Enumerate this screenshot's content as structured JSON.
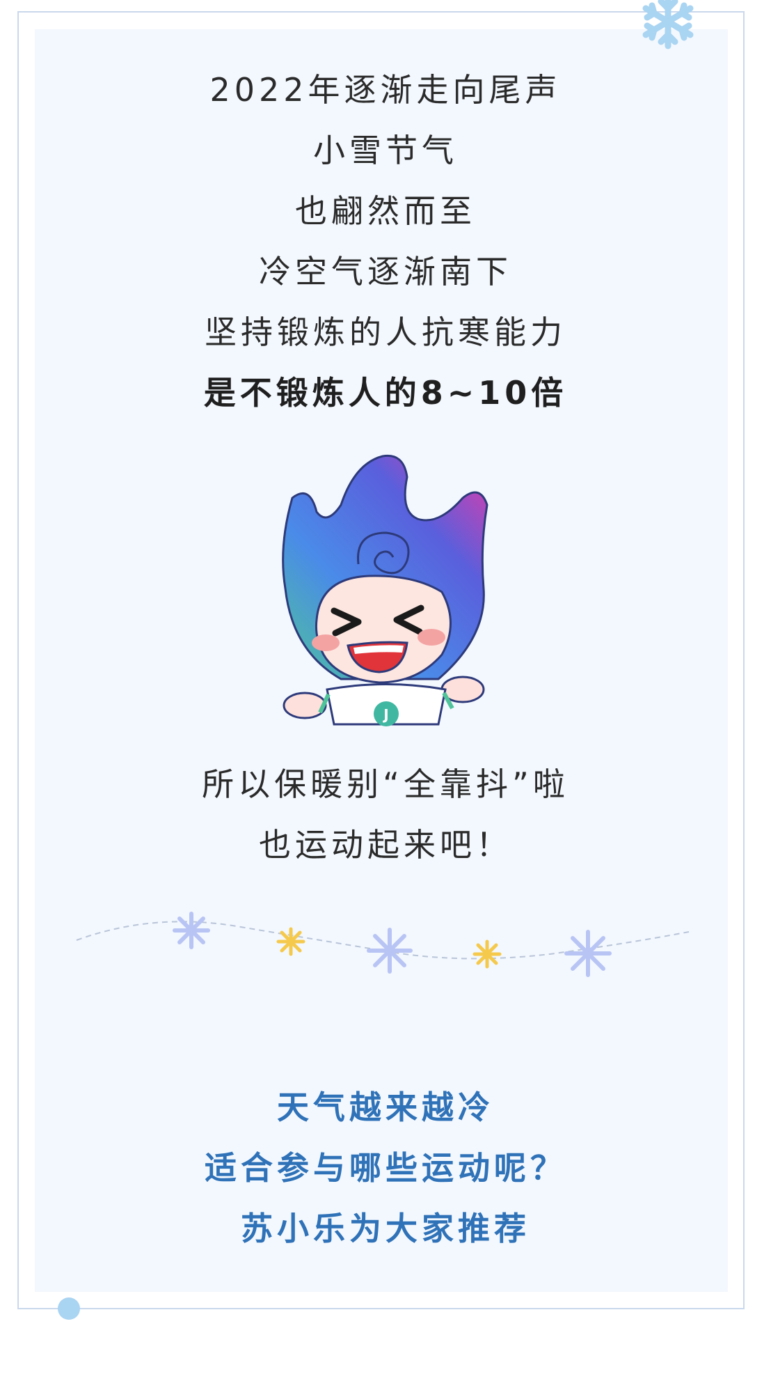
{
  "intro": {
    "lines": [
      "2022年逐渐走向尾声",
      "小雪节气",
      "也翩然而至",
      "冷空气逐渐南下",
      "坚持锻炼的人抗寒能力",
      "是不锻炼人的8~10倍"
    ]
  },
  "mascot": {
    "shirt_letter": "J"
  },
  "middle": {
    "lines": [
      "所以保暖别“全靠抖”啦",
      "也运动起来吧！"
    ]
  },
  "closing": {
    "lines": [
      "天气越来越冷",
      "适合参与哪些运动呢？",
      "苏小乐为大家推荐"
    ]
  },
  "colors": {
    "panel_background": "#f3f8fe",
    "frame_border": "#c9d8ec",
    "body_text": "#2a2a2a",
    "closing_text": "#2f72b8",
    "snowflake_light": "#a9d4f2",
    "snowflake_purple": "#b8c4f4",
    "snowflake_gold": "#f5c94c"
  },
  "icons": [
    "corner-snowflake-icon",
    "mascot-illustration",
    "snowflake-icon",
    "star-sparkle-icon"
  ]
}
